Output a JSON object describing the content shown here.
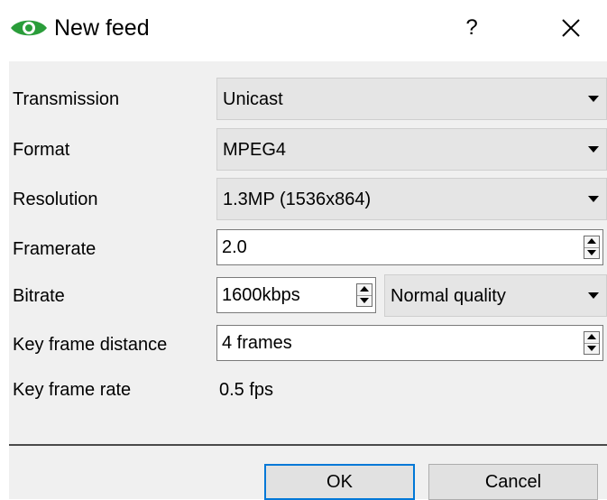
{
  "window": {
    "title": "New feed",
    "help_label": "?",
    "icons": {
      "app": "eye-icon",
      "close": "close-icon"
    },
    "accent_color": "#0078d7",
    "icon_color": "#2a9d3a"
  },
  "form": {
    "transmission": {
      "label": "Transmission",
      "value": "Unicast"
    },
    "format": {
      "label": "Format",
      "value": "MPEG4"
    },
    "resolution": {
      "label": "Resolution",
      "value": "1.3MP (1536x864)"
    },
    "framerate": {
      "label": "Framerate",
      "value": "2.0"
    },
    "bitrate": {
      "label": "Bitrate",
      "value": "1600kbps",
      "quality": "Normal quality"
    },
    "key_frame_distance": {
      "label": "Key frame distance",
      "value": "4 frames"
    },
    "key_frame_rate": {
      "label": "Key frame rate",
      "value": "0.5 fps"
    }
  },
  "buttons": {
    "ok": "OK",
    "cancel": "Cancel"
  }
}
